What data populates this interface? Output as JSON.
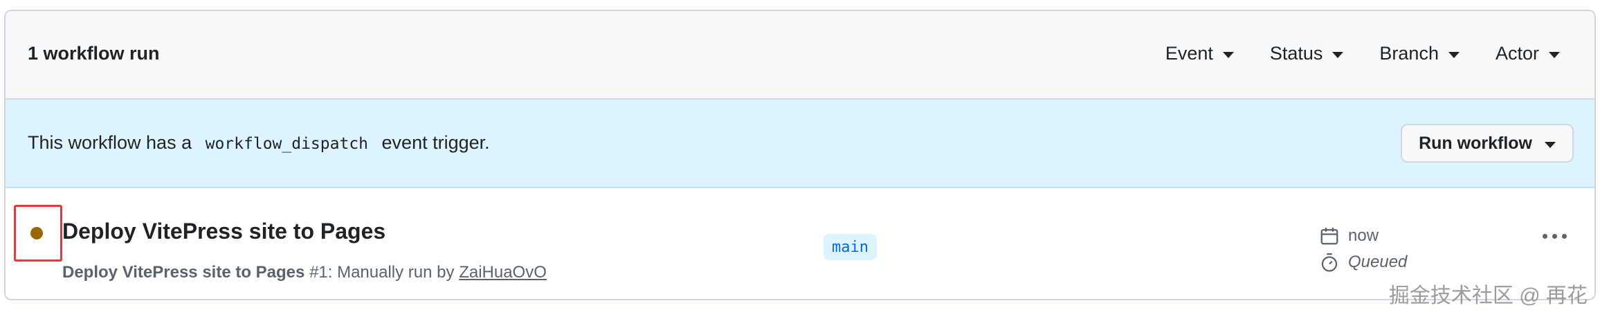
{
  "header": {
    "title": "1 workflow run",
    "filters": [
      {
        "label": "Event"
      },
      {
        "label": "Status"
      },
      {
        "label": "Branch"
      },
      {
        "label": "Actor"
      }
    ]
  },
  "banner": {
    "text_before": "This workflow has a",
    "code": "workflow_dispatch",
    "text_after": "event trigger.",
    "button_label": "Run workflow"
  },
  "run": {
    "status_color": "#9a6700",
    "title": "Deploy VitePress site to Pages",
    "workflow_name": "Deploy VitePress site to Pages",
    "meta_middle": "#1: Manually run by",
    "actor": "ZaiHuaOvO",
    "branch": "main",
    "time": "now",
    "status": "Queued"
  },
  "watermark": "掘金技术社区 @ 再花"
}
